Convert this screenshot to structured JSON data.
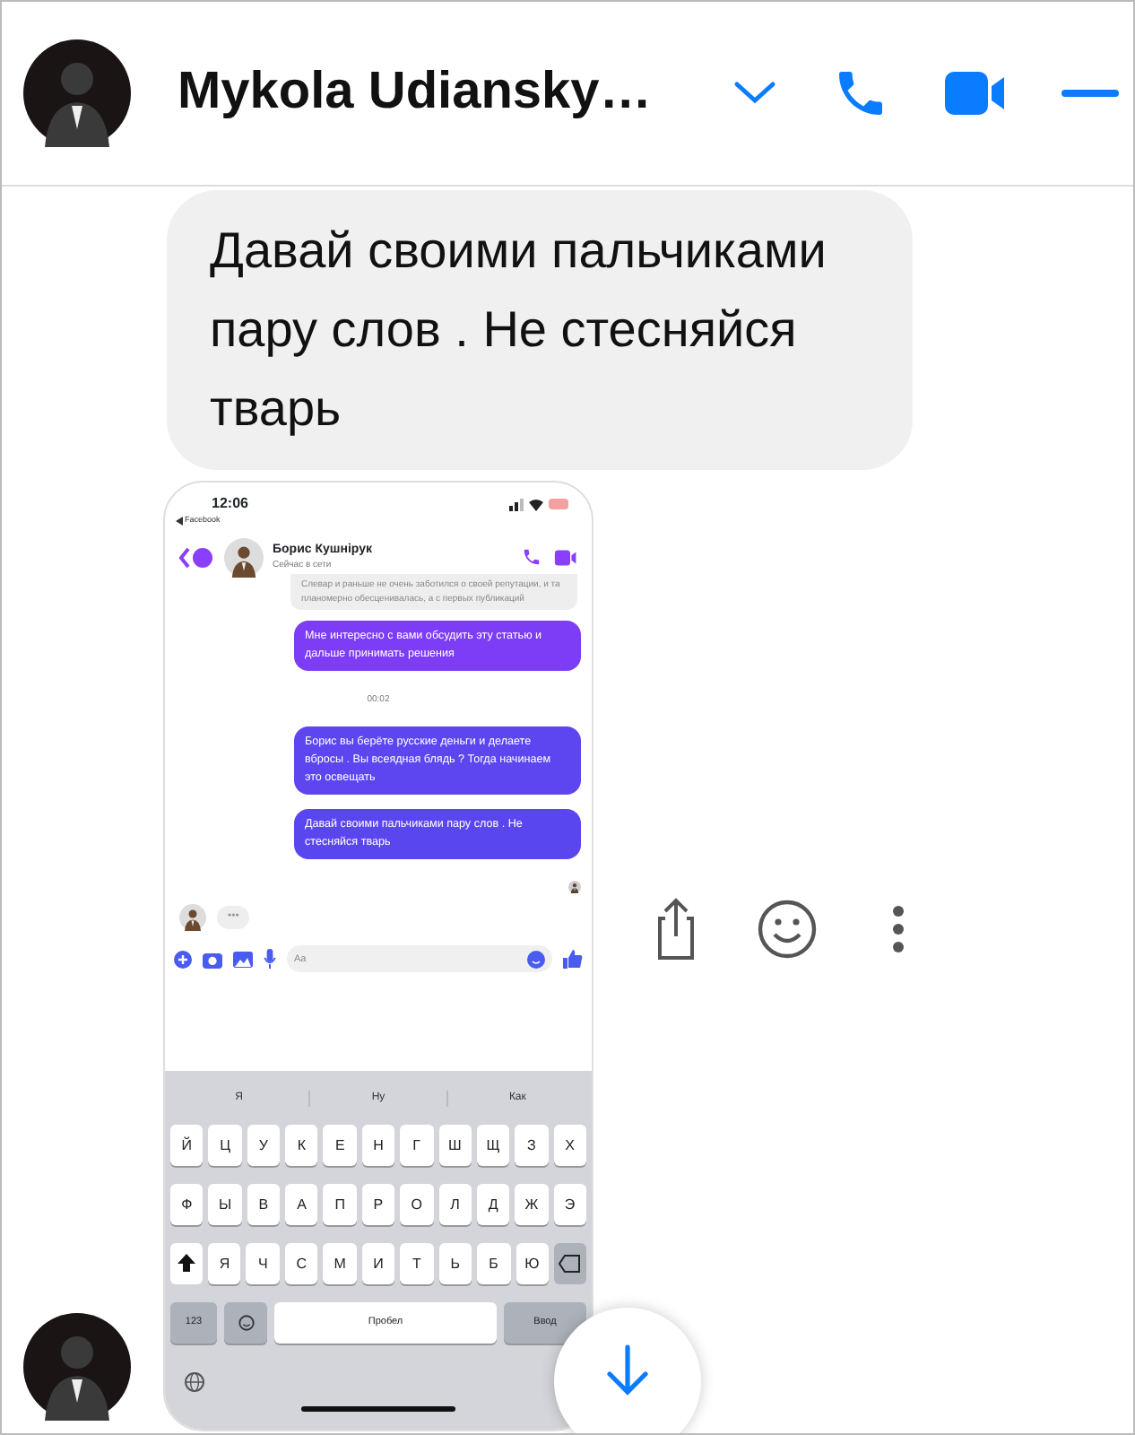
{
  "header": {
    "name": "Mykola Udiansky…"
  },
  "message": {
    "text": "Давай своими пальчиками пару слов . Не стесняйся тварь"
  },
  "screenshot": {
    "time": "12:06",
    "back_app": "Facebook",
    "contact_name": "Борис Кушнірук",
    "contact_status": "Сейчас в сети",
    "messages": [
      {
        "kind": "quote",
        "text": "Слевар и раньше не очень заботился о своей репутации, и та планомерно обесценивалась, а с первых публикаций"
      },
      {
        "kind": "outgoing",
        "text": "Мне интересно с вами обсудить эту статью и дальше принимать решения"
      },
      {
        "kind": "time",
        "text": "00:02"
      },
      {
        "kind": "outgoing",
        "text": "Борис вы берёте русские деньги и делаете вбросы . Вы всеядная блядь ? Тогда начинаем это освещать"
      },
      {
        "kind": "outgoing",
        "text": "Давай своими пальчиками пару слов . Не стесняйся тварь"
      }
    ],
    "typing": "•••",
    "composer_placeholder": "Aa",
    "suggestions": [
      "Я",
      "Ну",
      "Как"
    ],
    "key_rows": [
      [
        "Й",
        "Ц",
        "У",
        "К",
        "Е",
        "Н",
        "Г",
        "Ш",
        "Щ",
        "З",
        "Х"
      ],
      [
        "Ф",
        "Ы",
        "В",
        "А",
        "П",
        "Р",
        "О",
        "Л",
        "Д",
        "Ж",
        "Э"
      ],
      [
        "Я",
        "Ч",
        "С",
        "М",
        "И",
        "Т",
        "Ь",
        "Б",
        "Ю"
      ]
    ],
    "numbers_key": "123",
    "space_key": "Пробел",
    "return_key": "Ввод"
  }
}
